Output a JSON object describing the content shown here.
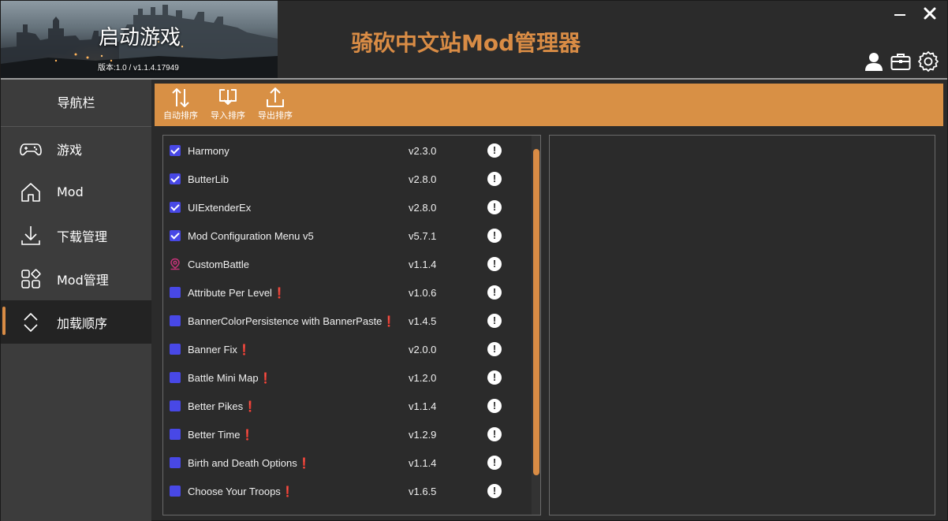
{
  "banner": {
    "title": "启动游戏",
    "version": "版本:1.0 / v1.1.4.17949"
  },
  "app_title": "骑砍中文站Mod管理器",
  "window_controls": {
    "minimize": "—",
    "close": "✕"
  },
  "header_icons": [
    "user-icon",
    "briefcase-icon",
    "settings-gear-icon"
  ],
  "sidebar": {
    "title": "导航栏",
    "items": [
      {
        "label": "游戏",
        "icon": "gamepad-icon",
        "active": false
      },
      {
        "label": "Mod",
        "icon": "home-icon",
        "active": false
      },
      {
        "label": "下载管理",
        "icon": "download-icon",
        "active": false
      },
      {
        "label": "Mod管理",
        "icon": "apps-grid-icon",
        "active": false
      },
      {
        "label": "加载顺序",
        "icon": "sort-arrows-icon",
        "active": true
      }
    ]
  },
  "toolbar": {
    "auto_sort": "自动排序",
    "import_sort": "导入排序",
    "export_sort": "导出排序"
  },
  "colors": {
    "accent": "#d98c45",
    "checkbox": "#4848e6",
    "warning": "#e02020",
    "background": "#2b2b2b",
    "sidebar": "#3c3c3c"
  },
  "mods": [
    {
      "name": "Harmony",
      "version": "v2.3.0",
      "checked": true,
      "warn": "",
      "icon": "checkbox"
    },
    {
      "name": "ButterLib",
      "version": "v2.8.0",
      "checked": true,
      "warn": "",
      "icon": "checkbox"
    },
    {
      "name": "UIExtenderEx",
      "version": "v2.8.0",
      "checked": true,
      "warn": "",
      "icon": "checkbox"
    },
    {
      "name": "Mod Configuration Menu v5",
      "version": "v5.7.1",
      "checked": true,
      "warn": "",
      "icon": "checkbox"
    },
    {
      "name": "CustomBattle",
      "version": "v1.1.4",
      "checked": false,
      "warn": "",
      "icon": "pin"
    },
    {
      "name": "Attribute Per Level",
      "version": "v1.0.6",
      "checked": false,
      "warn": "❗",
      "icon": "checkbox"
    },
    {
      "name": "BannerColorPersistence with BannerPaste",
      "version": "v1.4.5",
      "checked": false,
      "warn": "❗",
      "icon": "checkbox"
    },
    {
      "name": "Banner Fix",
      "version": "v2.0.0",
      "checked": false,
      "warn": "❗",
      "icon": "checkbox"
    },
    {
      "name": "Battle Mini Map",
      "version": "v1.2.0",
      "checked": false,
      "warn": "❗",
      "icon": "checkbox"
    },
    {
      "name": "Better Pikes",
      "version": "v1.1.4",
      "checked": false,
      "warn": "❗",
      "icon": "checkbox"
    },
    {
      "name": "Better Time",
      "version": "v1.2.9",
      "checked": false,
      "warn": "❗",
      "icon": "checkbox"
    },
    {
      "name": "Birth and Death Options",
      "version": "v1.1.4",
      "checked": false,
      "warn": "❗",
      "icon": "checkbox"
    },
    {
      "name": "Choose Your Troops",
      "version": "v1.6.5",
      "checked": false,
      "warn": "❗",
      "icon": "checkbox"
    }
  ],
  "info_glyph": "!"
}
